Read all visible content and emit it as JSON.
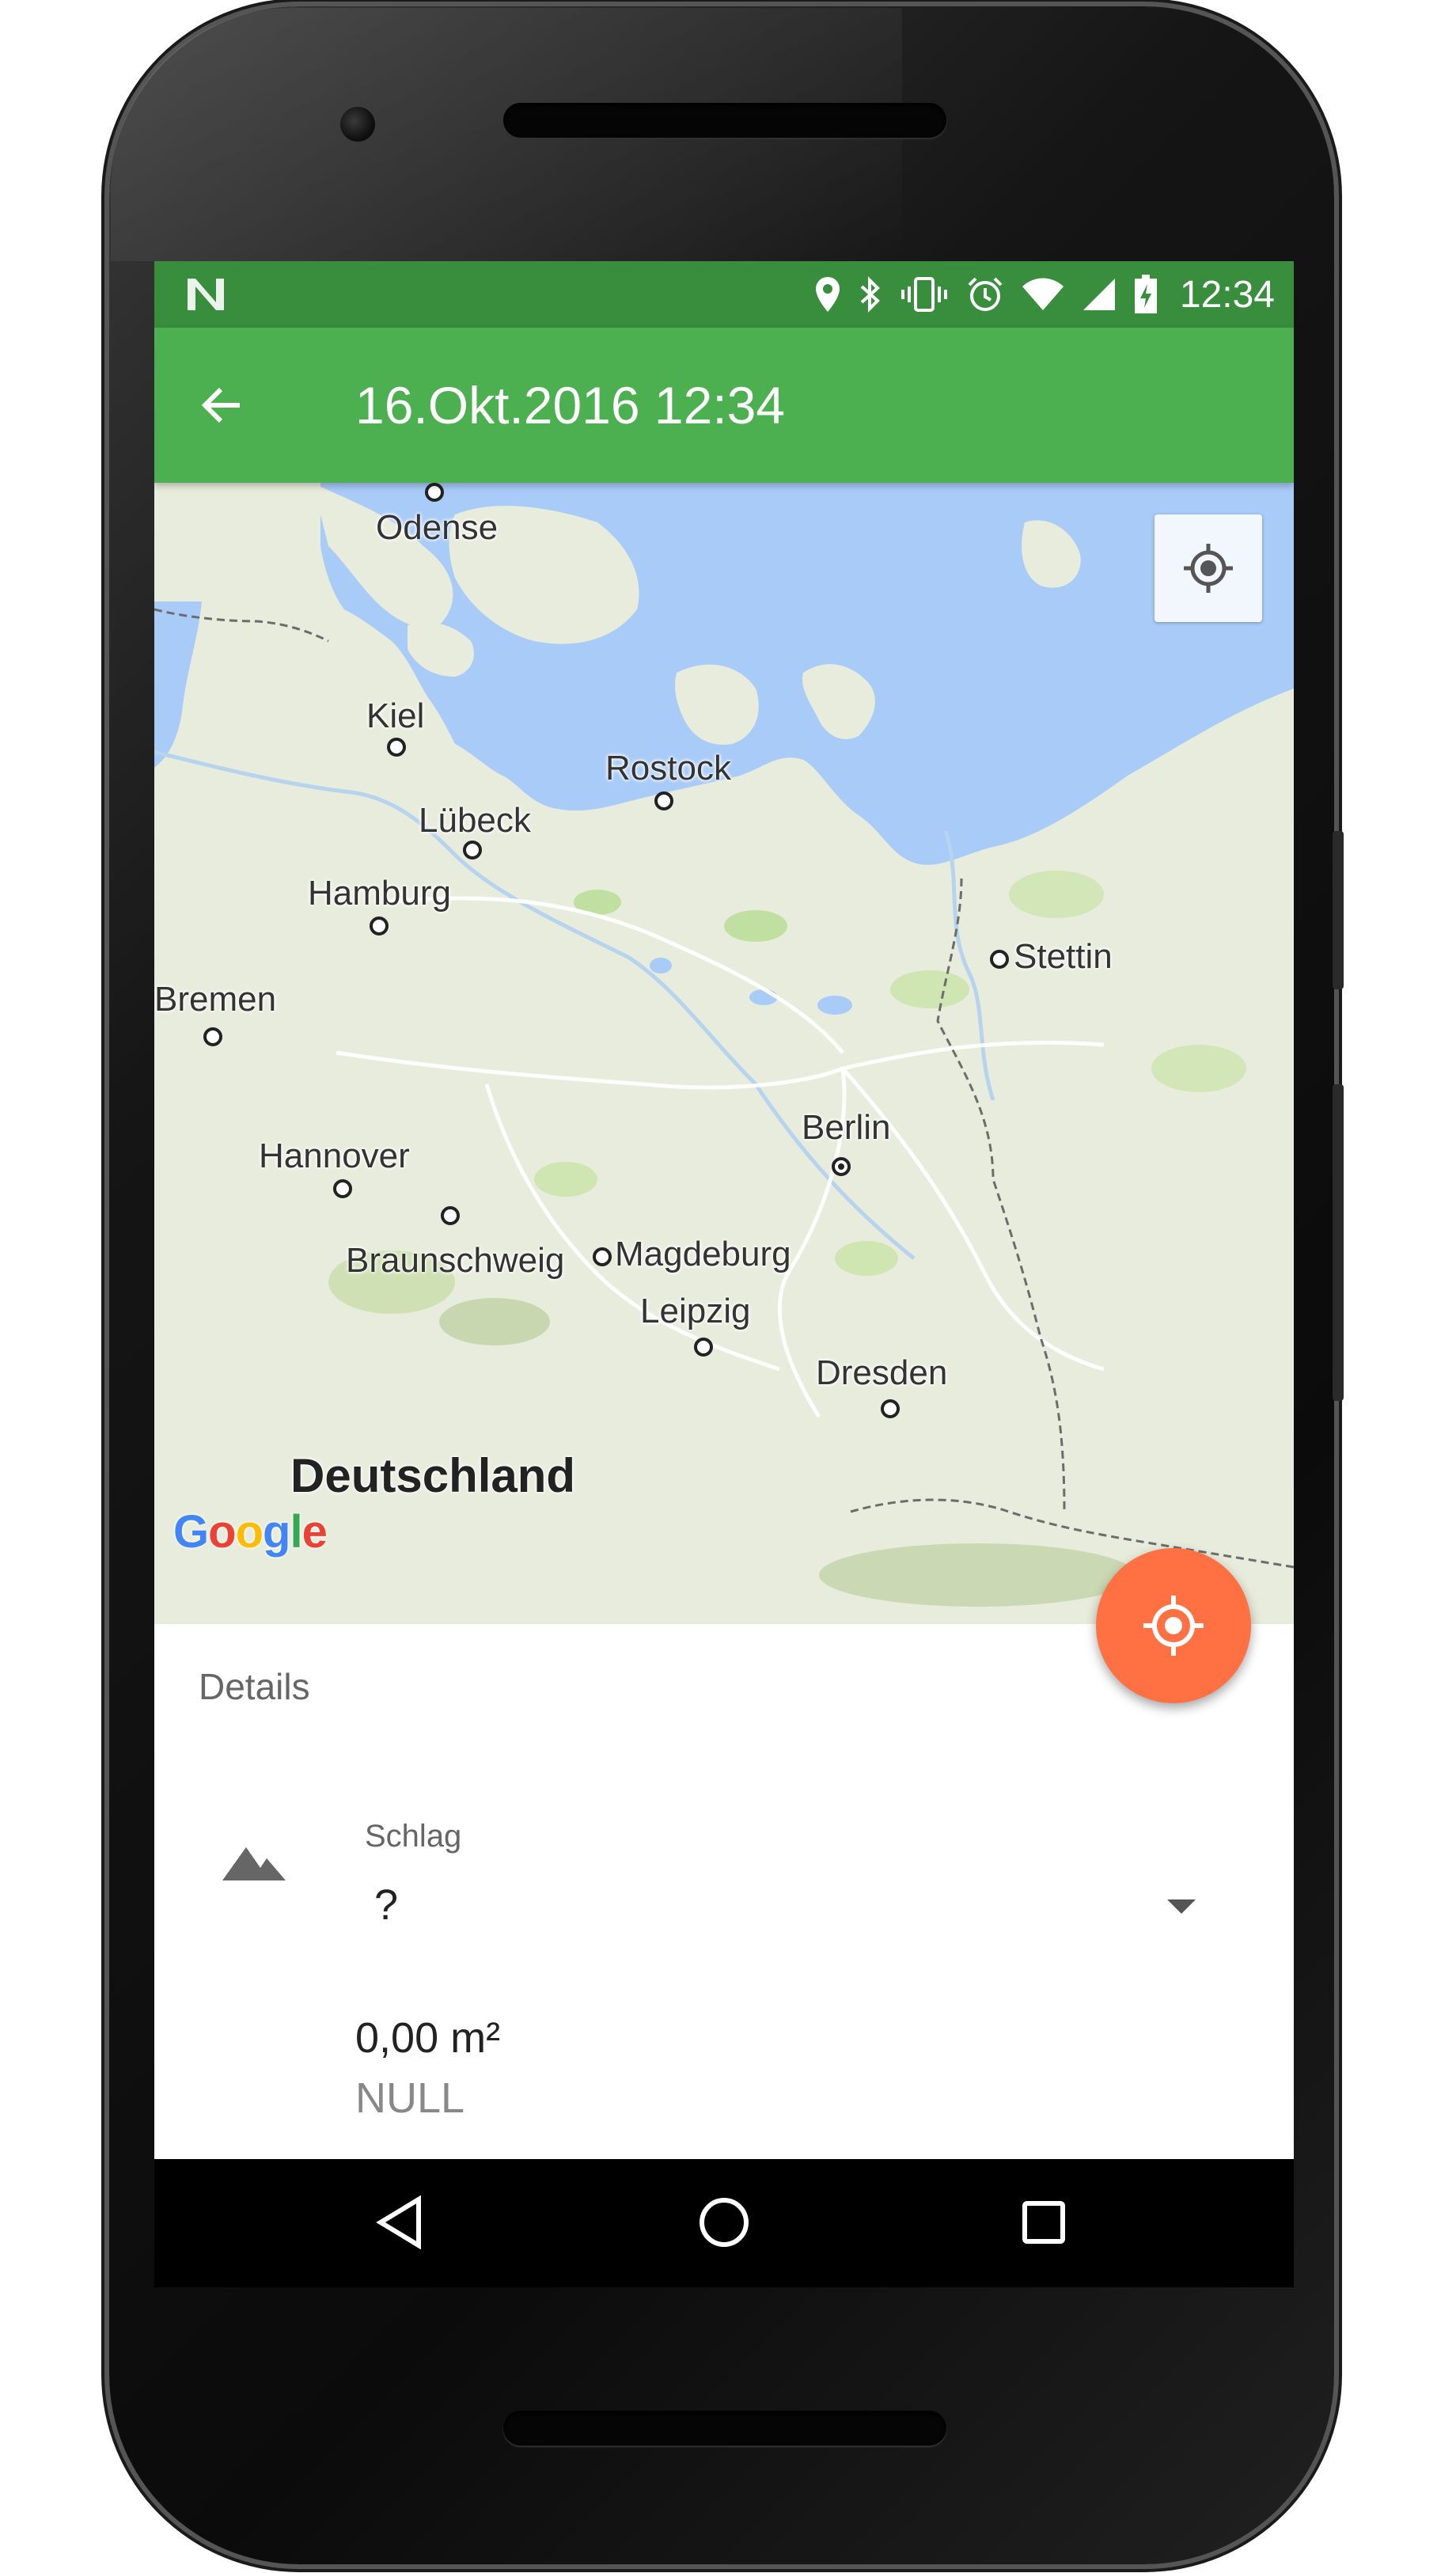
{
  "statusbar": {
    "time": "12:34",
    "icons": [
      "notification-n-icon",
      "location-icon",
      "bluetooth-icon",
      "vibrate-icon",
      "alarm-icon",
      "wifi-icon",
      "signal-icon",
      "battery-charging-icon"
    ]
  },
  "toolbar": {
    "title": "16.Okt.2016 12:34",
    "back_icon": "arrow-back-icon"
  },
  "map": {
    "cities": {
      "odense": "Odense",
      "kiel": "Kiel",
      "rostock": "Rostock",
      "luebeck": "Lübeck",
      "hamburg": "Hamburg",
      "stettin": "Stettin",
      "bremen": "Bremen",
      "berlin": "Berlin",
      "hannover": "Hannover",
      "braunschweig": "Braunschweig",
      "magdeburg": "Magdeburg",
      "leipzig": "Leipzig",
      "dresden": "Dresden"
    },
    "country": "Deutschland",
    "attribution": {
      "letters": [
        "G",
        "o",
        "o",
        "g",
        "l",
        "e"
      ],
      "colors": [
        "#4285F4",
        "#EA4335",
        "#FBBC05",
        "#4285F4",
        "#34A853",
        "#EA4335"
      ]
    },
    "my_location_icon": "crosshair-icon"
  },
  "fab": {
    "icon": "gps-fixed-icon",
    "color": "#FF7043"
  },
  "details": {
    "title": "Details",
    "field": {
      "label": "Schlag",
      "value": "?",
      "icon": "terrain-icon"
    },
    "area": "0,00 m²",
    "note": "NULL"
  },
  "colors": {
    "statusbar": "#388E3C",
    "toolbar": "#4CAF50",
    "water": "#A8CBF7"
  },
  "navbar": {
    "icons": [
      "back-triangle-icon",
      "home-circle-icon",
      "recents-square-icon"
    ]
  }
}
